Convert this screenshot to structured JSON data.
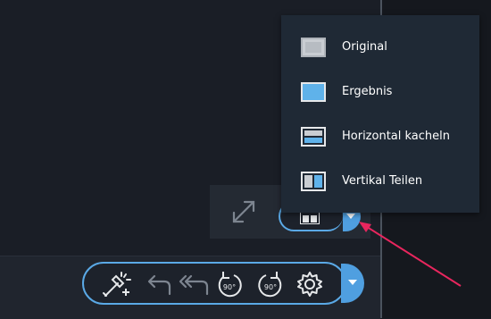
{
  "view_menu": {
    "items": [
      {
        "label": "Original",
        "icon": "original-view-icon"
      },
      {
        "label": "Ergebnis",
        "icon": "result-view-icon"
      },
      {
        "label": "Horizontal kacheln",
        "icon": "horizontal-tile-icon"
      },
      {
        "label": "Vertikal Teilen",
        "icon": "vertical-split-icon"
      }
    ]
  },
  "toolbar": {
    "tools": [
      {
        "name": "magic-wand-icon"
      },
      {
        "name": "undo-icon"
      },
      {
        "name": "undo-all-icon"
      },
      {
        "name": "rotate-left-90-icon",
        "text": "90°"
      },
      {
        "name": "rotate-right-90-icon",
        "text": "90°"
      },
      {
        "name": "settings-icon"
      }
    ]
  },
  "colors": {
    "accent": "#4f9fe0",
    "menu_bg": "#1f2935",
    "arrow": "#e8265e",
    "icon_gray": "#7d8590",
    "icon_light": "#e6e8ea"
  }
}
